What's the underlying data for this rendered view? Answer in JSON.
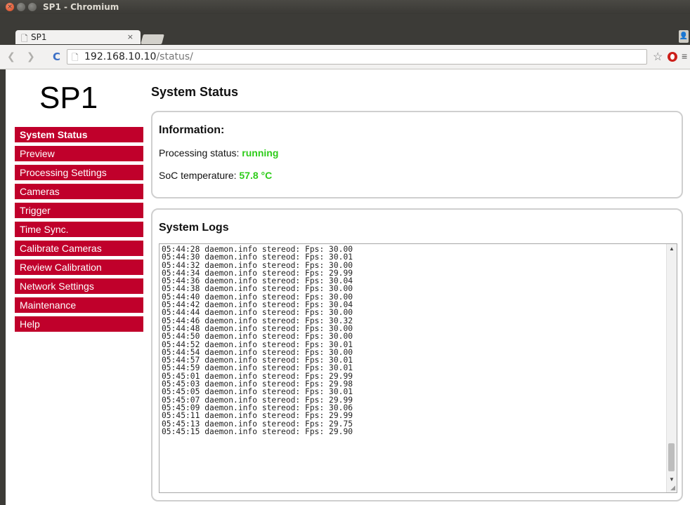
{
  "window": {
    "title": "SP1 - Chromium"
  },
  "tab": {
    "label": "SP1",
    "close": "×"
  },
  "address_bar": {
    "host": "192.168.10.10",
    "path": "/status/"
  },
  "logo": "SP1",
  "nav": [
    {
      "label": "System Status"
    },
    {
      "label": "Preview"
    },
    {
      "label": "Processing Settings"
    },
    {
      "label": "Cameras"
    },
    {
      "label": "Trigger"
    },
    {
      "label": "Time Sync."
    },
    {
      "label": "Calibrate Cameras"
    },
    {
      "label": "Review Calibration"
    },
    {
      "label": "Network Settings"
    },
    {
      "label": "Maintenance"
    },
    {
      "label": "Help"
    }
  ],
  "page_title": "System Status",
  "information": {
    "heading": "Information:",
    "processing_label": "Processing status: ",
    "processing_value": "running",
    "temp_label": "SoC temperature: ",
    "temp_value": "57.8 °C"
  },
  "logs": {
    "heading": "System Logs",
    "lines": [
      "05:44:28 daemon.info stereod: Fps: 30.00",
      "05:44:30 daemon.info stereod: Fps: 30.01",
      "05:44:32 daemon.info stereod: Fps: 30.00",
      "05:44:34 daemon.info stereod: Fps: 29.99",
      "05:44:36 daemon.info stereod: Fps: 30.04",
      "05:44:38 daemon.info stereod: Fps: 30.00",
      "05:44:40 daemon.info stereod: Fps: 30.00",
      "05:44:42 daemon.info stereod: Fps: 30.04",
      "05:44:44 daemon.info stereod: Fps: 30.00",
      "05:44:46 daemon.info stereod: Fps: 30.32",
      "05:44:48 daemon.info stereod: Fps: 30.00",
      "05:44:50 daemon.info stereod: Fps: 30.00",
      "05:44:52 daemon.info stereod: Fps: 30.01",
      "05:44:54 daemon.info stereod: Fps: 30.00",
      "05:44:57 daemon.info stereod: Fps: 30.01",
      "05:44:59 daemon.info stereod: Fps: 30.01",
      "05:45:01 daemon.info stereod: Fps: 29.99",
      "05:45:03 daemon.info stereod: Fps: 29.98",
      "05:45:05 daemon.info stereod: Fps: 30.01",
      "05:45:07 daemon.info stereod: Fps: 29.99",
      "05:45:09 daemon.info stereod: Fps: 30.06",
      "05:45:11 daemon.info stereod: Fps: 29.99",
      "05:45:13 daemon.info stereod: Fps: 29.75",
      "05:45:15 daemon.info stereod: Fps: 29.90"
    ]
  },
  "colors": {
    "nav_red": "#c0002b",
    "status_green": "#2ecc1a"
  }
}
